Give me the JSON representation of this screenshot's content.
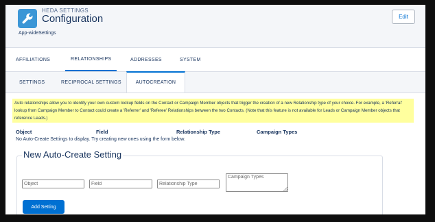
{
  "header": {
    "eyebrow": "HEDA SETTINGS",
    "title": "Configuration",
    "subtitle": "App-wideSettings",
    "edit_label": "Edit",
    "icon": "wrench-icon",
    "icon_color": "#3b96d6"
  },
  "tabs": [
    {
      "label": "AFFILIATIONS",
      "active": false
    },
    {
      "label": "RELATIONSHIPS",
      "active": true
    },
    {
      "label": "ADDRESSES",
      "active": false
    },
    {
      "label": "SYSTEM",
      "active": false
    }
  ],
  "subtabs": [
    {
      "label": "SETTINGS",
      "active": false
    },
    {
      "label": "RECIPROCAL SETTINGS",
      "active": false
    },
    {
      "label": "AUTOCREATION",
      "active": true
    }
  ],
  "notice": {
    "text": "Auto relationships allow you to identify your own custom lookup fields on the Contact or Campaign Member objects that trigger the creation of a new Relationship type of your choice. For example, a 'Referral' lookup from Campaign Member to Contact could create a 'Referrer' and 'Referee' Relationships between the two Contacts. (Note that this feature is not available for Leads or Campaign Member objects that reference Leads.)",
    "highlight_color": "#ffff9e"
  },
  "table": {
    "columns": [
      "Object",
      "Field",
      "Relationship Type",
      "Campaign Types"
    ],
    "empty_message": "No Auto-Create Settings to display. Try creating new ones using the form below."
  },
  "form": {
    "title": "New Auto-Create Setting",
    "object_placeholder": "Object",
    "field_placeholder": "Field",
    "relationship_type_placeholder": "Relationship Type",
    "campaign_types_placeholder": "Campaign Types",
    "add_label": "Add Setting"
  },
  "colors": {
    "brand": "#0070d2",
    "text": "#16325c",
    "frame": "#0e0e0e"
  }
}
